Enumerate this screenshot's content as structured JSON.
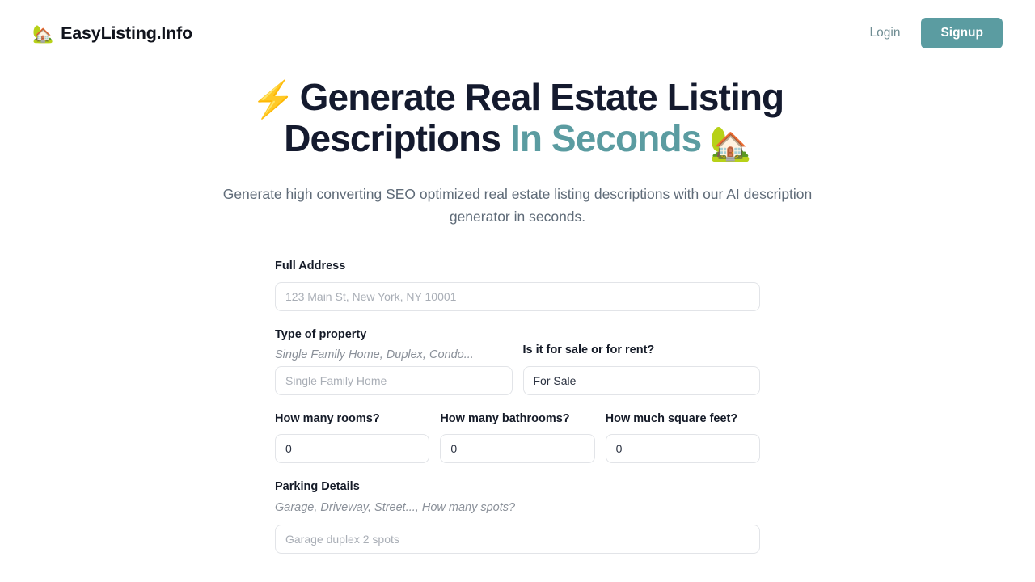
{
  "header": {
    "brand_emoji": "🏡",
    "brand_name": "EasyListing.Info",
    "login_label": "Login",
    "signup_label": "Signup",
    "accent_color": "#5b9ca1"
  },
  "hero": {
    "bolt_emoji": "⚡",
    "title_line1": "Generate Real Estate",
    "title_line2": "Listing Descriptions",
    "title_accent": "In Seconds",
    "house_emoji": "🏡",
    "subtitle": "Generate high converting SEO optimized real estate listing descriptions with our AI description generator in seconds.",
    "title_color": "#141a2e",
    "accent_color": "#5b9ca1"
  },
  "form": {
    "address": {
      "label": "Full Address",
      "placeholder": "123 Main St, New York, NY 10001",
      "value": ""
    },
    "property_type": {
      "label": "Type of property",
      "hint": "Single Family Home, Duplex, Condo...",
      "placeholder": "Single Family Home",
      "value": ""
    },
    "sale_or_rent": {
      "label": "Is it for sale or for rent?",
      "placeholder": "For Sale",
      "value": "For Sale"
    },
    "rooms": {
      "label": "How many rooms?",
      "placeholder": "0",
      "value": "0"
    },
    "bathrooms": {
      "label": "How many bathrooms?",
      "placeholder": "0",
      "value": "0"
    },
    "square_feet": {
      "label": "How much square feet?",
      "placeholder": "0",
      "value": "0"
    },
    "parking": {
      "label": "Parking Details",
      "hint": "Garage, Driveway, Street..., How many spots?",
      "placeholder": "Garage duplex 2 spots",
      "value": ""
    }
  }
}
